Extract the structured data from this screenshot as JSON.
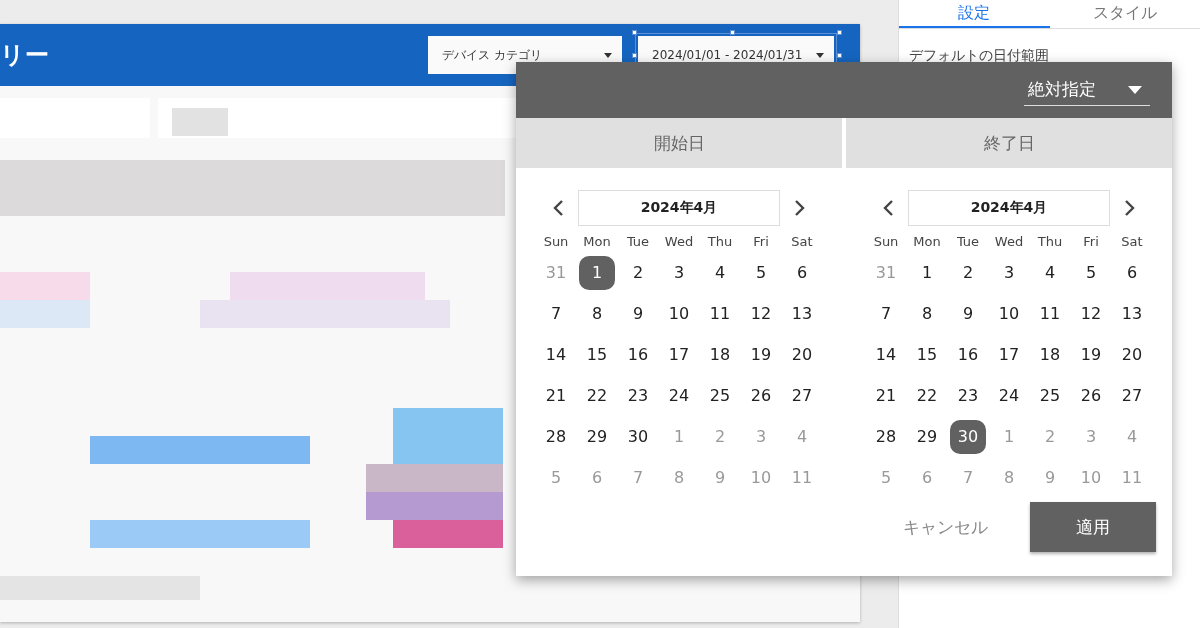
{
  "report": {
    "title": "リー",
    "filters": [
      {
        "label": "デバイス カテゴリ",
        "selected": false
      },
      {
        "label": "2024/01/01 - 2024/01/31",
        "selected": true
      }
    ]
  },
  "side_panel": {
    "tabs": [
      {
        "label": "設定",
        "selected": true
      },
      {
        "label": "スタイル",
        "selected": false
      }
    ],
    "field_label": "デフォルトの日付範囲"
  },
  "date_picker": {
    "mode": "絶対指定",
    "calendars": [
      {
        "heading": "開始日",
        "month": "2024年4月",
        "weekdays": [
          "Sun",
          "Mon",
          "Tue",
          "Wed",
          "Thu",
          "Fri",
          "Sat"
        ],
        "weeks": [
          [
            {
              "d": "31",
              "outside": true,
              "selected": false
            },
            {
              "d": "1",
              "outside": false,
              "selected": true
            },
            {
              "d": "2",
              "outside": false,
              "selected": false
            },
            {
              "d": "3",
              "outside": false,
              "selected": false
            },
            {
              "d": "4",
              "outside": false,
              "selected": false
            },
            {
              "d": "5",
              "outside": false,
              "selected": false
            },
            {
              "d": "6",
              "outside": false,
              "selected": false
            }
          ],
          [
            {
              "d": "7",
              "outside": false,
              "selected": false
            },
            {
              "d": "8",
              "outside": false,
              "selected": false
            },
            {
              "d": "9",
              "outside": false,
              "selected": false
            },
            {
              "d": "10",
              "outside": false,
              "selected": false
            },
            {
              "d": "11",
              "outside": false,
              "selected": false
            },
            {
              "d": "12",
              "outside": false,
              "selected": false
            },
            {
              "d": "13",
              "outside": false,
              "selected": false
            }
          ],
          [
            {
              "d": "14",
              "outside": false,
              "selected": false
            },
            {
              "d": "15",
              "outside": false,
              "selected": false
            },
            {
              "d": "16",
              "outside": false,
              "selected": false
            },
            {
              "d": "17",
              "outside": false,
              "selected": false
            },
            {
              "d": "18",
              "outside": false,
              "selected": false
            },
            {
              "d": "19",
              "outside": false,
              "selected": false
            },
            {
              "d": "20",
              "outside": false,
              "selected": false
            }
          ],
          [
            {
              "d": "21",
              "outside": false,
              "selected": false
            },
            {
              "d": "22",
              "outside": false,
              "selected": false
            },
            {
              "d": "23",
              "outside": false,
              "selected": false
            },
            {
              "d": "24",
              "outside": false,
              "selected": false
            },
            {
              "d": "25",
              "outside": false,
              "selected": false
            },
            {
              "d": "26",
              "outside": false,
              "selected": false
            },
            {
              "d": "27",
              "outside": false,
              "selected": false
            }
          ],
          [
            {
              "d": "28",
              "outside": false,
              "selected": false
            },
            {
              "d": "29",
              "outside": false,
              "selected": false
            },
            {
              "d": "30",
              "outside": false,
              "selected": false
            },
            {
              "d": "1",
              "outside": true,
              "selected": false
            },
            {
              "d": "2",
              "outside": true,
              "selected": false
            },
            {
              "d": "3",
              "outside": true,
              "selected": false
            },
            {
              "d": "4",
              "outside": true,
              "selected": false
            }
          ],
          [
            {
              "d": "5",
              "outside": true,
              "selected": false
            },
            {
              "d": "6",
              "outside": true,
              "selected": false
            },
            {
              "d": "7",
              "outside": true,
              "selected": false
            },
            {
              "d": "8",
              "outside": true,
              "selected": false
            },
            {
              "d": "9",
              "outside": true,
              "selected": false
            },
            {
              "d": "10",
              "outside": true,
              "selected": false
            },
            {
              "d": "11",
              "outside": true,
              "selected": false
            }
          ]
        ]
      },
      {
        "heading": "終了日",
        "month": "2024年4月",
        "weekdays": [
          "Sun",
          "Mon",
          "Tue",
          "Wed",
          "Thu",
          "Fri",
          "Sat"
        ],
        "weeks": [
          [
            {
              "d": "31",
              "outside": true,
              "selected": false
            },
            {
              "d": "1",
              "outside": false,
              "selected": false
            },
            {
              "d": "2",
              "outside": false,
              "selected": false
            },
            {
              "d": "3",
              "outside": false,
              "selected": false
            },
            {
              "d": "4",
              "outside": false,
              "selected": false
            },
            {
              "d": "5",
              "outside": false,
              "selected": false
            },
            {
              "d": "6",
              "outside": false,
              "selected": false
            }
          ],
          [
            {
              "d": "7",
              "outside": false,
              "selected": false
            },
            {
              "d": "8",
              "outside": false,
              "selected": false
            },
            {
              "d": "9",
              "outside": false,
              "selected": false
            },
            {
              "d": "10",
              "outside": false,
              "selected": false
            },
            {
              "d": "11",
              "outside": false,
              "selected": false
            },
            {
              "d": "12",
              "outside": false,
              "selected": false
            },
            {
              "d": "13",
              "outside": false,
              "selected": false
            }
          ],
          [
            {
              "d": "14",
              "outside": false,
              "selected": false
            },
            {
              "d": "15",
              "outside": false,
              "selected": false
            },
            {
              "d": "16",
              "outside": false,
              "selected": false
            },
            {
              "d": "17",
              "outside": false,
              "selected": false
            },
            {
              "d": "18",
              "outside": false,
              "selected": false
            },
            {
              "d": "19",
              "outside": false,
              "selected": false
            },
            {
              "d": "20",
              "outside": false,
              "selected": false
            }
          ],
          [
            {
              "d": "21",
              "outside": false,
              "selected": false
            },
            {
              "d": "22",
              "outside": false,
              "selected": false
            },
            {
              "d": "23",
              "outside": false,
              "selected": false
            },
            {
              "d": "24",
              "outside": false,
              "selected": false
            },
            {
              "d": "25",
              "outside": false,
              "selected": false
            },
            {
              "d": "26",
              "outside": false,
              "selected": false
            },
            {
              "d": "27",
              "outside": false,
              "selected": false
            }
          ],
          [
            {
              "d": "28",
              "outside": false,
              "selected": false
            },
            {
              "d": "29",
              "outside": false,
              "selected": false
            },
            {
              "d": "30",
              "outside": false,
              "selected": true
            },
            {
              "d": "1",
              "outside": true,
              "selected": false
            },
            {
              "d": "2",
              "outside": true,
              "selected": false
            },
            {
              "d": "3",
              "outside": true,
              "selected": false
            },
            {
              "d": "4",
              "outside": true,
              "selected": false
            }
          ],
          [
            {
              "d": "5",
              "outside": true,
              "selected": false
            },
            {
              "d": "6",
              "outside": true,
              "selected": false
            },
            {
              "d": "7",
              "outside": true,
              "selected": false
            },
            {
              "d": "8",
              "outside": true,
              "selected": false
            },
            {
              "d": "9",
              "outside": true,
              "selected": false
            },
            {
              "d": "10",
              "outside": true,
              "selected": false
            },
            {
              "d": "11",
              "outside": true,
              "selected": false
            }
          ]
        ]
      }
    ],
    "buttons": [
      {
        "label": "キャンセル",
        "kind": "text"
      },
      {
        "label": "適用",
        "kind": "filled"
      }
    ]
  }
}
